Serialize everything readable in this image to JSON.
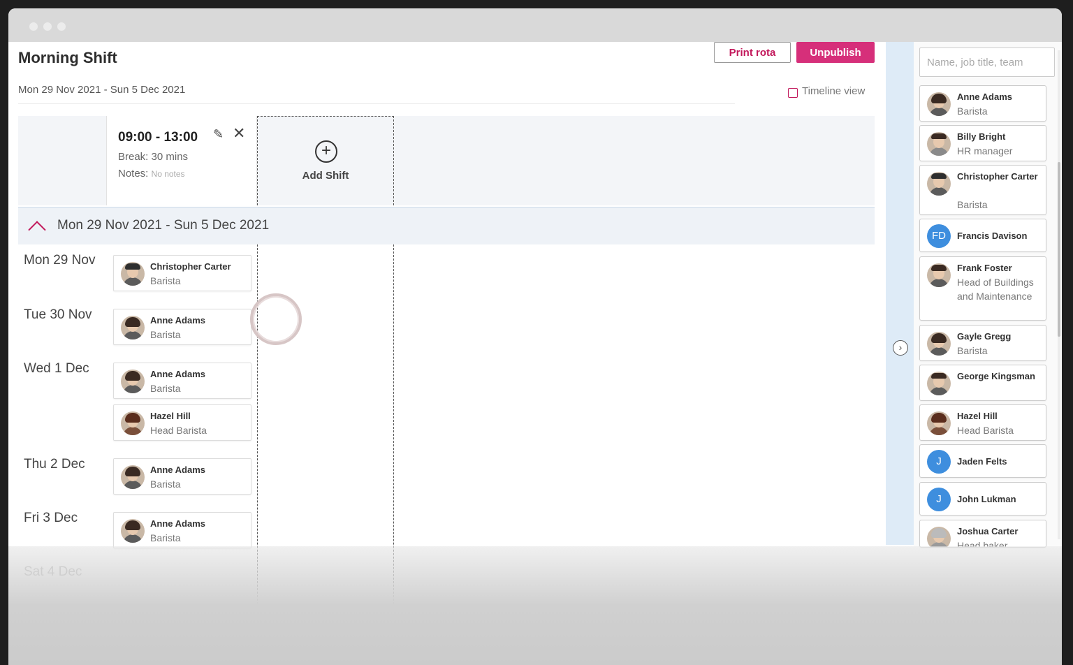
{
  "page": {
    "title": "Morning Shift",
    "date_range": "Mon 29 Nov 2021 - Sun 5 Dec 2021",
    "print_label": "Print rota",
    "unpublish_label": "Unpublish",
    "timeline_label": "Timeline view"
  },
  "shift": {
    "time": "09:00 - 13:00",
    "break": "Break: 30 mins",
    "notes_label": "Notes:",
    "notes_value": "No notes",
    "add_label": "Add Shift"
  },
  "week": {
    "label": "Mon 29 Nov 2021 - Sun 5 Dec 2021"
  },
  "days": [
    {
      "label": "Mon 29 Nov"
    },
    {
      "label": "Tue 30 Nov"
    },
    {
      "label": "Wed 1 Dec"
    },
    {
      "label": "Thu 2 Dec"
    },
    {
      "label": "Fri 3 Dec"
    },
    {
      "label": "Sat 4 Dec"
    }
  ],
  "assignments": [
    {
      "name": "Christopher Carter",
      "role": "Barista"
    },
    {
      "name": "Anne Adams",
      "role": "Barista"
    },
    {
      "name": "Anne Adams",
      "role": "Barista"
    },
    {
      "name": "Hazel Hill",
      "role": "Head Barista"
    },
    {
      "name": "Anne Adams",
      "role": "Barista"
    },
    {
      "name": "Anne Adams",
      "role": "Barista"
    }
  ],
  "sidebar": {
    "search_placeholder": "Name, job title, team",
    "employees": [
      {
        "name": "Anne Adams",
        "role": "Barista"
      },
      {
        "name": "Billy Bright",
        "role": "HR manager"
      },
      {
        "name": "Christopher Carter",
        "role": "Barista"
      },
      {
        "name": "Francis Davison",
        "role": "",
        "initials": "FD"
      },
      {
        "name": "Frank Foster",
        "role": "Head of Buildings and Maintenance"
      },
      {
        "name": "Gayle Gregg",
        "role": "Barista"
      },
      {
        "name": "George Kingsman",
        "role": ""
      },
      {
        "name": "Hazel Hill",
        "role": "Head Barista"
      },
      {
        "name": "Jaden Felts",
        "role": "",
        "initials": "J"
      },
      {
        "name": "John Lukman",
        "role": "",
        "initials": "J"
      },
      {
        "name": "Joshua Carter",
        "role": "Head baker"
      }
    ]
  },
  "colors": {
    "accent": "#d62f7a",
    "avatar_blue": "#3e8ede"
  },
  "icons": {
    "edit": "pencil-icon",
    "close": "close-icon",
    "add": "plus-circle-icon",
    "collapse": "chevron-up-icon",
    "next": "chevron-right-circle-icon",
    "timeline": "timeline-icon"
  }
}
